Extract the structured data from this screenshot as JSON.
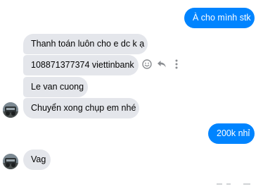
{
  "conversation": {
    "messages": [
      {
        "sender": "me",
        "text": "À cho mình stk"
      },
      {
        "sender": "contact",
        "text": "Thanh toán luôn cho e dc k ạ"
      },
      {
        "sender": "contact",
        "text": "108871377374 viettinbank"
      },
      {
        "sender": "contact",
        "text": "Le van cuong"
      },
      {
        "sender": "contact",
        "text": "Chuyển xong chụp em nhé"
      },
      {
        "sender": "me",
        "text": "200k nhỉ"
      },
      {
        "sender": "contact",
        "text": "Vag"
      }
    ]
  },
  "message_actions": {
    "icons": [
      "smiley-icon",
      "reply-icon",
      "more-options-icon"
    ]
  },
  "colors": {
    "outgoing_bubble": "#0084ff",
    "incoming_bubble": "#e4e6eb",
    "icon_gray": "#8a8d91"
  }
}
